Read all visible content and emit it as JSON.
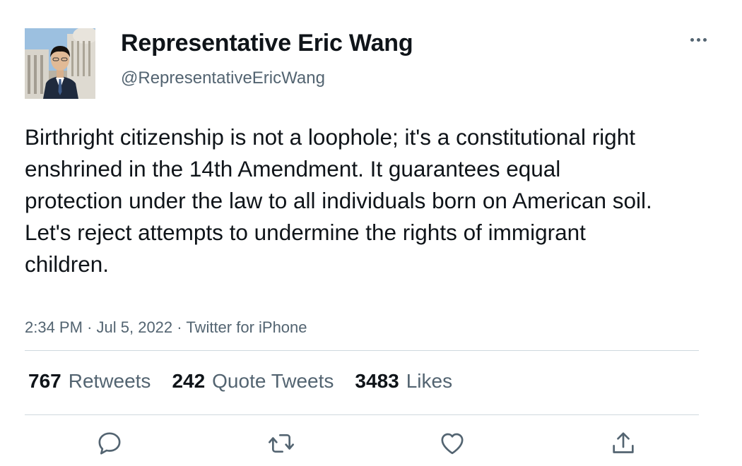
{
  "user": {
    "display_name": "Representative Eric Wang",
    "handle": "@RepresentativeEricWang"
  },
  "tweet": {
    "text": "Birthright citizenship is not a loophole; it's a constitutional right enshrined in the 14th Amendment. It guarantees equal protection under the law to all individuals born on American soil. Let's reject attempts to undermine the rights of immigrant children.",
    "time": "2:34 PM",
    "separator": "·",
    "date": "Jul 5, 2022",
    "source": "Twitter for iPhone"
  },
  "stats": {
    "retweets_count": "767",
    "retweets_label": "Retweets",
    "quotes_count": "242",
    "quotes_label": "Quote Tweets",
    "likes_count": "3483",
    "likes_label": "Likes"
  },
  "icons": {
    "more": "more-horizontal-icon",
    "reply": "reply-icon",
    "retweet": "retweet-icon",
    "like": "heart-icon",
    "share": "share-icon"
  },
  "colors": {
    "text_primary": "#0f1419",
    "text_secondary": "#536471",
    "divider": "#cfd9de"
  }
}
